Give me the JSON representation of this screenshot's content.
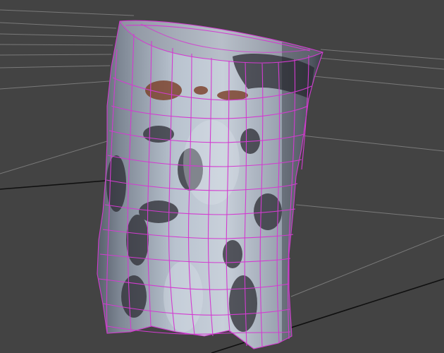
{
  "viewport": {
    "background_color": "#434343",
    "grid_line_color": "#8c8c8c",
    "grid_major_line_color": "#101010"
  },
  "object": {
    "kind": "birch stump mesh",
    "selected": true,
    "wireframe_color": "#d33bd1",
    "bark_color": "#b6c0cc",
    "bark_shadow_color": "#6d7480",
    "bark_dark_mark_color": "#2c2c33",
    "bark_scar_color": "#7a3d25"
  }
}
